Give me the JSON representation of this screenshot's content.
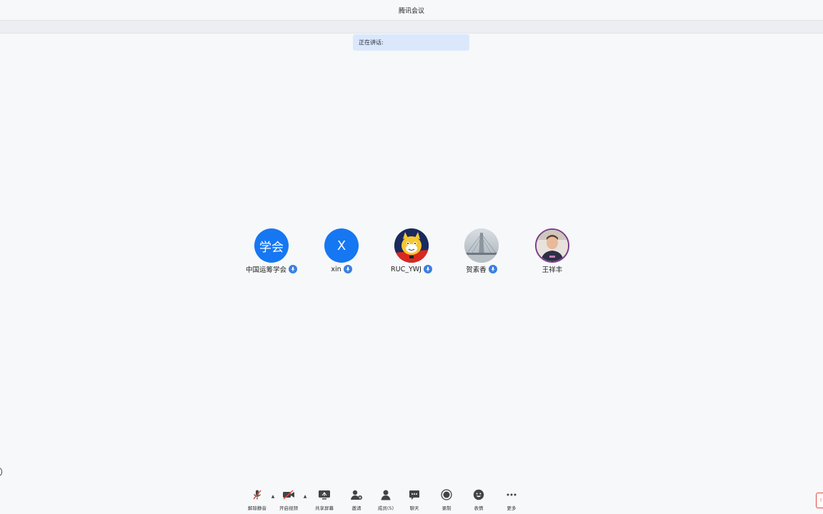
{
  "window": {
    "title": "腾讯会议"
  },
  "speaking": {
    "label": "正在讲话:"
  },
  "participants": [
    {
      "name": "中国运筹学会",
      "avatar_text": "学会",
      "avatar_type": "text",
      "mic_icon": "mic-badge-icon"
    },
    {
      "name": "xin",
      "avatar_text": "X",
      "avatar_type": "text",
      "mic_icon": "mic-badge-icon"
    },
    {
      "name": "RUC_YWJ",
      "avatar_type": "image",
      "avatar_icon": "cartoon-cat-avatar",
      "mic_icon": "mic-badge-icon"
    },
    {
      "name": "贺素香",
      "avatar_type": "image",
      "avatar_icon": "bridge-photo-avatar",
      "mic_icon": "mic-badge-icon"
    },
    {
      "name": "王祥丰",
      "avatar_type": "image",
      "avatar_icon": "person-photo-avatar"
    }
  ],
  "toolbar": {
    "unmute": "解除静音",
    "start_video": "开启视频",
    "share_screen": "共享屏幕",
    "invite": "邀请",
    "members": "成员(5)",
    "chat": "聊天",
    "record": "录制",
    "reactions": "表情",
    "more": "更多"
  },
  "colors": {
    "accent": "#1677f2",
    "mute_red": "#e5483b",
    "speaking_bg": "#dbe8fb",
    "background": "#f7f8fa"
  }
}
